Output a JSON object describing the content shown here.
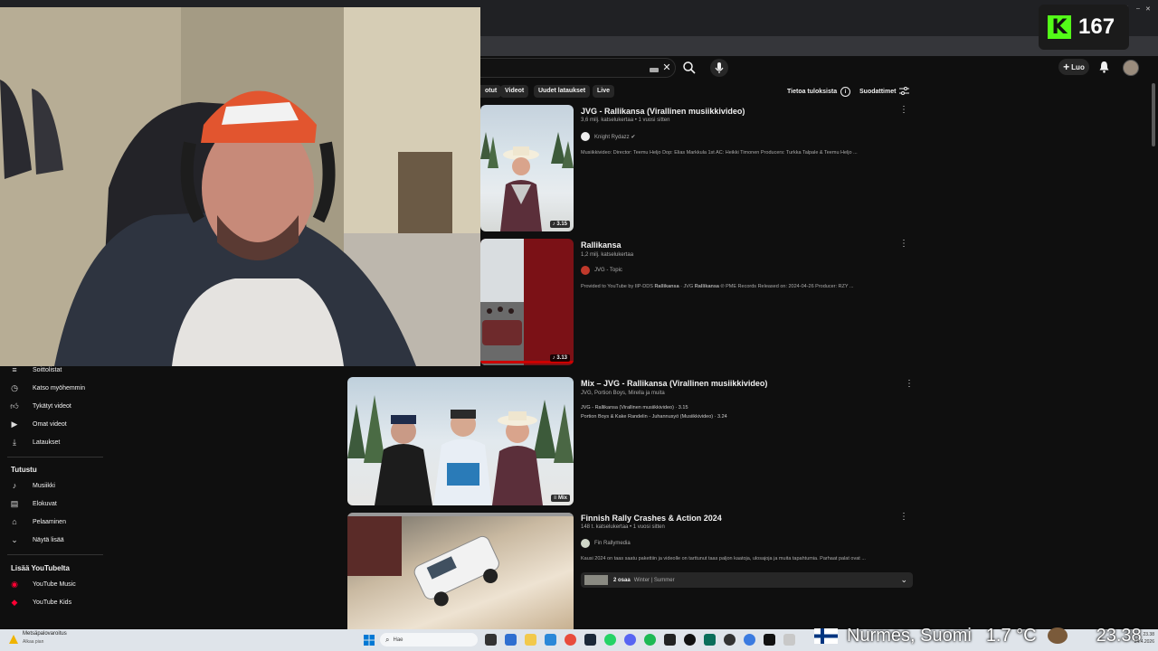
{
  "browser": {
    "minimize": "–",
    "maximize": "□",
    "close": "✕"
  },
  "header": {
    "search_clear": "✕",
    "create_label": "Luo",
    "icons": [
      "search-icon",
      "mic-icon",
      "bell-icon",
      "avatar"
    ]
  },
  "chips": [
    {
      "label": "otut"
    },
    {
      "label": "Videot"
    },
    {
      "label": "Uudet lataukset"
    },
    {
      "label": "Live"
    }
  ],
  "filters": {
    "results_info": "Tietoa tuloksista",
    "filters_label": "Suodattimet"
  },
  "sidebar": {
    "items_top": [
      {
        "label": "Soittolistat",
        "icon": "playlist-icon"
      },
      {
        "label": "Katso myöhemmin",
        "icon": "clock-icon"
      },
      {
        "label": "Tykätyt videot",
        "icon": "thumb-up-icon"
      },
      {
        "label": "Omat videot",
        "icon": "video-icon"
      },
      {
        "label": "Lataukset",
        "icon": "download-icon"
      }
    ],
    "explore_title": "Tutustu",
    "explore": [
      {
        "label": "Musiikki",
        "icon": "music-icon"
      },
      {
        "label": "Elokuvat",
        "icon": "film-icon"
      },
      {
        "label": "Pelaaminen",
        "icon": "gamepad-icon"
      },
      {
        "label": "Näytä lisää",
        "icon": "chevron-down-icon"
      }
    ],
    "more_title": "Lisää YouTubelta",
    "more": [
      {
        "label": "YouTube Music",
        "icon": "youtube-music-icon"
      },
      {
        "label": "YouTube Kids",
        "icon": "youtube-kids-icon"
      }
    ]
  },
  "results": [
    {
      "title": "JVG - Rallikansa (Virallinen musiikkivideo)",
      "meta": "3,6 milj. katselukertaa • 1 vuosi sitten",
      "channel": "Knight Rydazz",
      "verified": "✔",
      "desc": "Musiikkivideo: Director: Teemu Heljo Dop: Elias Markkula 1st AC: Heikki Timonen Producers: Turkka Talpale & Teemu Heljo ...",
      "duration": "3.15"
    },
    {
      "title": "Rallikansa",
      "meta": "1,2 milj. katselukertaa",
      "channel": "JVG - Topic",
      "desc_a": "Provided to YouTube by IIP-DDS ",
      "desc_b": "Rallikansa",
      "desc_c": " · JVG ",
      "desc_d": "Rallikansa",
      "desc_e": " ℗ PME Records Released on: 2024-04-26 Producer: RZY ...",
      "duration": "3.13"
    },
    {
      "title": "Mix – JVG  - Rallikansa (Virallinen musiikkivideo)",
      "meta": "JVG, Portion Boys, Mirella ja muita",
      "line1": "JVG - Rallikansa (Virallinen musiikkivideo) · 3.15",
      "line2": "Portion Boys & Kake Randelin - Juhannusyö (Musiikkivideo) · 3.24",
      "badge": "Mix"
    },
    {
      "title": "Finnish Rally Crashes & Action 2024",
      "meta": "148 t. katselukertaa • 1 vuosi sitten",
      "channel": "Fin Rallymedia",
      "desc": "Kausi 2024 on taas saatu pakettiin ja videolle on tarttunut taas paljon kaatoja, ulosajoja ja muita tapahtumia. Parhaat palat ovat ...",
      "chapters_label": "2 osaa",
      "chapters_text": "Winter | Summer"
    }
  ],
  "kick": {
    "count": "167"
  },
  "taskbar": {
    "notification_title": "Metsäpalovaroitus",
    "notification_sub": "Alkaa pian",
    "search_placeholder": "Hae",
    "tray_time": "23.38",
    "tray_date": "24.4.2026"
  },
  "overlay": {
    "location": "Nurmes, Suomi",
    "temperature": "1.7 °C",
    "clock": "23.38"
  }
}
